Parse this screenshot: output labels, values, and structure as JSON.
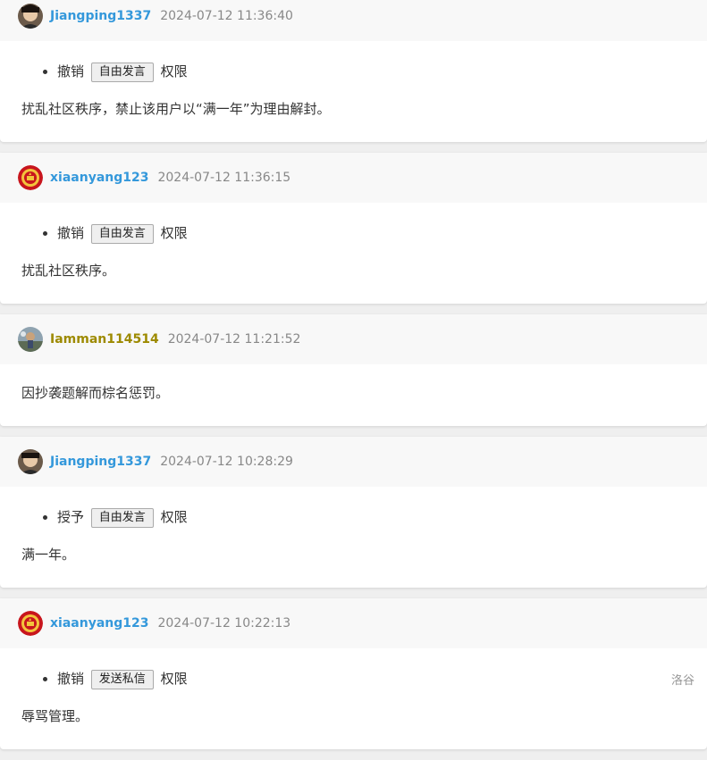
{
  "colors": {
    "blue_user": "#3498db",
    "gold_user": "#9d8a00",
    "timestamp": "#888888"
  },
  "entries": [
    {
      "username": "Jiangping1337",
      "user_color": "#3498db",
      "avatar_icon": "avatar-photo-icon",
      "timestamp": "2024-07-12 11:36:40",
      "has_perm": true,
      "perm_action": "撤销",
      "perm_name": "自由发言",
      "perm_suffix": "权限",
      "reason": "扰乱社区秩序，禁止该用户以“满一年”为理由解封。"
    },
    {
      "username": "xiaanyang123",
      "user_color": "#3498db",
      "avatar_icon": "avatar-emblem-icon",
      "timestamp": "2024-07-12 11:36:15",
      "has_perm": true,
      "perm_action": "撤销",
      "perm_name": "自由发言",
      "perm_suffix": "权限",
      "reason": "扰乱社区秩序。"
    },
    {
      "username": "Iamman114514",
      "user_color": "#9d8a00",
      "avatar_icon": "avatar-scenery-icon",
      "timestamp": "2024-07-12 11:21:52",
      "has_perm": false,
      "reason": "因抄袭题解而棕名惩罚。"
    },
    {
      "username": "Jiangping1337",
      "user_color": "#3498db",
      "avatar_icon": "avatar-photo-icon",
      "timestamp": "2024-07-12 10:28:29",
      "has_perm": true,
      "perm_action": "授予",
      "perm_name": "自由发言",
      "perm_suffix": "权限",
      "reason": "满一年。"
    },
    {
      "username": "xiaanyang123",
      "user_color": "#3498db",
      "avatar_icon": "avatar-emblem-icon",
      "timestamp": "2024-07-12 10:22:13",
      "has_perm": true,
      "perm_action": "撤销",
      "perm_name": "发送私信",
      "perm_suffix": "权限",
      "reason": "辱骂管理。"
    }
  ],
  "footer": {
    "brand": "洛谷"
  }
}
